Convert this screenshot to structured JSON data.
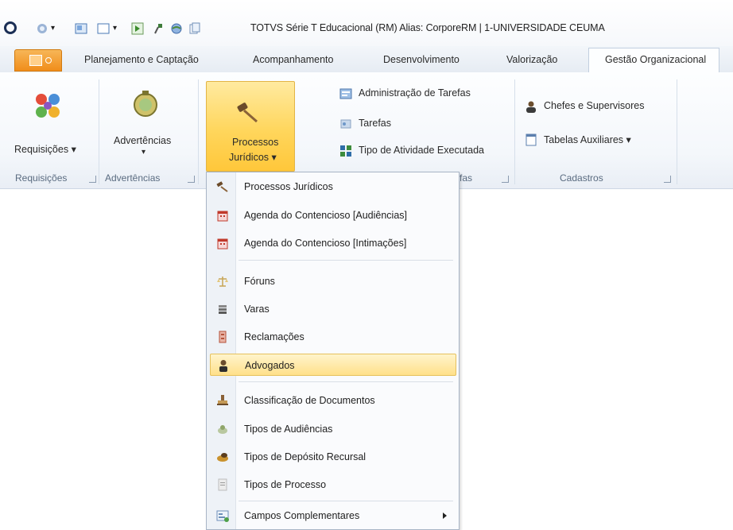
{
  "window": {
    "title": "TOTVS Série T Educacional (RM) Alias: CorporeRM | 1-UNIVERSIDADE CEUMA"
  },
  "tabs": [
    {
      "label": "Planejamento e Captação"
    },
    {
      "label": "Acompanhamento"
    },
    {
      "label": "Desenvolvimento"
    },
    {
      "label": "Valorização"
    },
    {
      "label": "Gestão Organizacional"
    }
  ],
  "ribbon": {
    "requisicoes": {
      "button": "Requisições ▾",
      "group": "Requisições"
    },
    "advertencias": {
      "button_line1": "Advertências",
      "button_line2": "▾",
      "group": "Advertências"
    },
    "processos": {
      "button_line1": "Processos",
      "button_line2": "Jurídicos ▾"
    },
    "tarefas_group": {
      "items": [
        "Administração de Tarefas",
        "Tarefas",
        "Tipo de Atividade Executada"
      ],
      "group_partial": "fas"
    },
    "cadastros": {
      "items": [
        "Chefes e Supervisores",
        "Tabelas Auxiliares ▾"
      ],
      "group": "Cadastros"
    }
  },
  "menu": {
    "items": [
      {
        "label": "Processos Jurídicos",
        "icon": "gavel-icon"
      },
      {
        "label": "Agenda do Contencioso [Audiências]",
        "icon": "calendar-icon"
      },
      {
        "label": "Agenda do Contencioso [Intimações]",
        "icon": "calendar-icon"
      },
      {
        "label": "Fóruns",
        "icon": "scales-icon"
      },
      {
        "label": "Varas",
        "icon": "stack-icon"
      },
      {
        "label": "Reclamações",
        "icon": "complaint-icon"
      },
      {
        "label": "Advogados",
        "icon": "lawyer-icon"
      },
      {
        "label": "Classificação de Documentos",
        "icon": "stamp-icon"
      },
      {
        "label": "Tipos de Audiências",
        "icon": "hearing-icon"
      },
      {
        "label": "Tipos de Depósito Recursal",
        "icon": "deposit-icon"
      },
      {
        "label": "Tipos de Processo",
        "icon": "document-icon"
      },
      {
        "label": "Campos Complementares",
        "icon": "fields-icon"
      }
    ],
    "highlighted": "Advogados"
  },
  "colors": {
    "accent_orange": "#f08d1a",
    "highlight_yellow": "#ffd65c",
    "ribbon_bg": "#f4f7fb"
  }
}
